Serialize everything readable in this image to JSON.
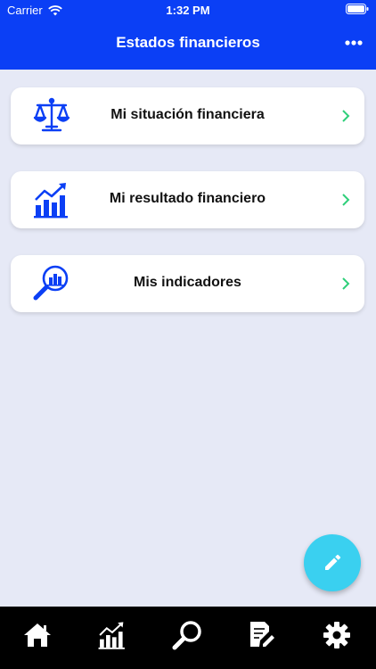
{
  "status_bar": {
    "carrier": "Carrier",
    "time": "1:32 PM"
  },
  "nav": {
    "title": "Estados financieros",
    "more_icon": "more-horizontal-icon"
  },
  "menu": [
    {
      "label": "Mi situación financiera",
      "icon": "scale-balance-icon"
    },
    {
      "label": "Mi resultado financiero",
      "icon": "growth-chart-icon"
    },
    {
      "label": "Mis indicadores",
      "icon": "magnify-chart-icon"
    }
  ],
  "fab": {
    "icon": "pencil-icon"
  },
  "tabs": [
    {
      "icon": "home-icon"
    },
    {
      "icon": "growth-chart-icon"
    },
    {
      "icon": "search-icon"
    },
    {
      "icon": "edit-document-icon"
    },
    {
      "icon": "gear-icon"
    }
  ],
  "colors": {
    "primary": "#0b3ff5",
    "background": "#e6e9f6",
    "chevron": "#2fcf7a",
    "fab": "#3ad0f0",
    "tabbar": "#000000"
  }
}
